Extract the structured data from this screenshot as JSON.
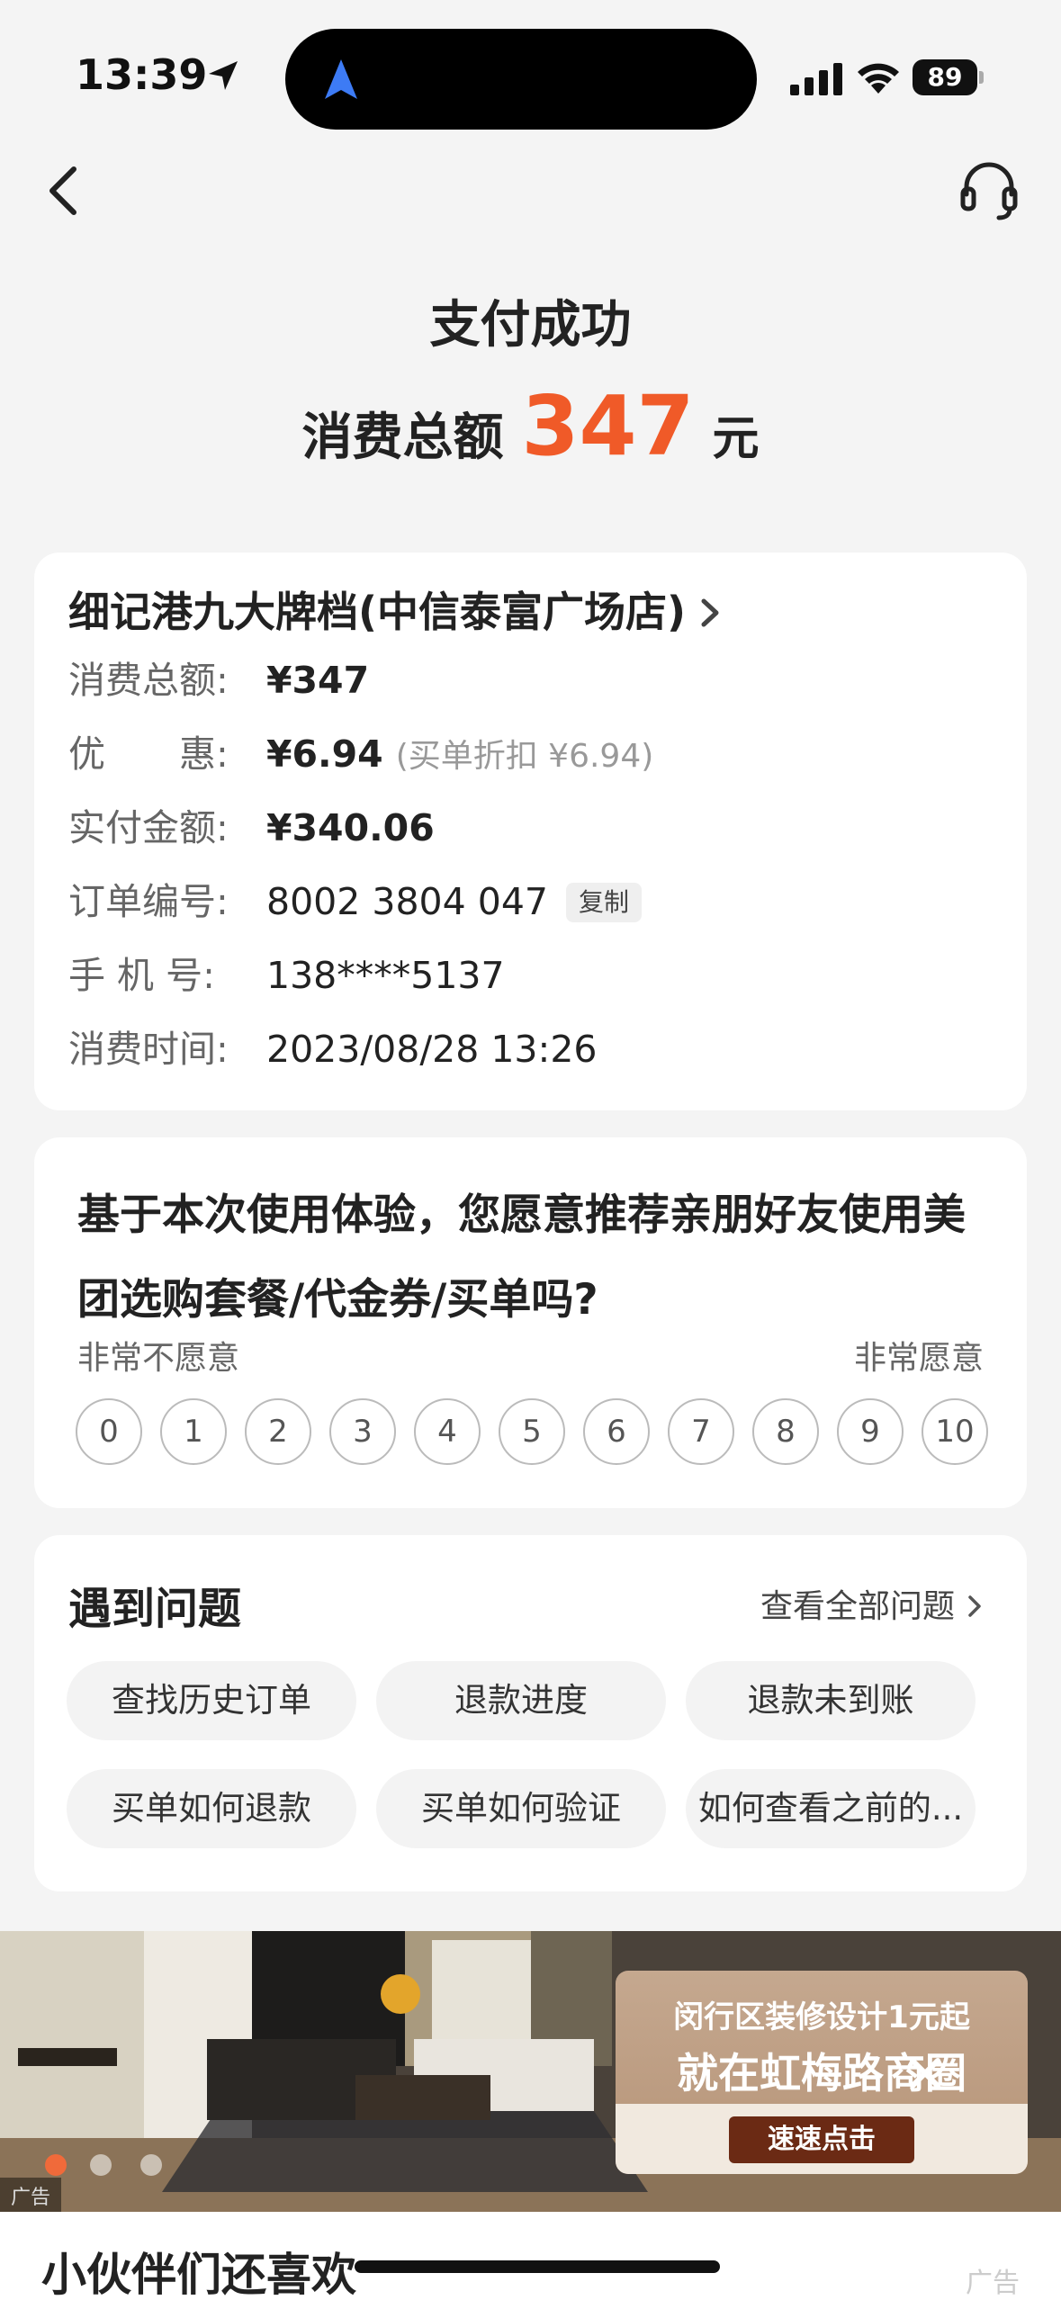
{
  "status_bar": {
    "time": "13:39",
    "battery": "89"
  },
  "header": {
    "title": "支付成功",
    "amount_label": "消费总额",
    "amount_value": "347",
    "amount_unit": "元"
  },
  "order": {
    "merchant": "细记港九大牌档(中信泰富广场店)",
    "rows": [
      {
        "label": "消费总额:",
        "value": "¥347"
      },
      {
        "label": "优　　惠:",
        "value": "¥6.94",
        "note": "(买单折扣 ¥6.94)"
      },
      {
        "label": "实付金额:",
        "value": "¥340.06"
      },
      {
        "label": "订单编号:",
        "value": "8002 3804 047",
        "copy": "复制"
      },
      {
        "label": "手  机  号:",
        "value": "138****5137"
      },
      {
        "label": "消费时间:",
        "value": "2023/08/28 13:26"
      }
    ]
  },
  "survey": {
    "question": "基于本次使用体验，您愿意推荐亲朋好友使用美团选购套餐/代金券/买单吗?",
    "low_label": "非常不愿意",
    "high_label": "非常愿意",
    "scores": [
      "0",
      "1",
      "2",
      "3",
      "4",
      "5",
      "6",
      "7",
      "8",
      "9",
      "10"
    ]
  },
  "faq": {
    "title": "遇到问题",
    "view_all": "查看全部问题",
    "items": [
      "查找历史订单",
      "退款进度",
      "退款未到账",
      "买单如何退款",
      "买单如何验证",
      "如何查看之前的..."
    ]
  },
  "ad": {
    "line1": "闵行区装修设计1元起",
    "line2": "就在虹梅路商圈",
    "cta": "速速点击",
    "tag": "广告"
  },
  "more": {
    "title": "小伙伴们还喜欢",
    "ad_label": "广告"
  },
  "colors": {
    "accent": "#f05a28",
    "background": "#f4f4f4",
    "card": "#ffffff"
  }
}
